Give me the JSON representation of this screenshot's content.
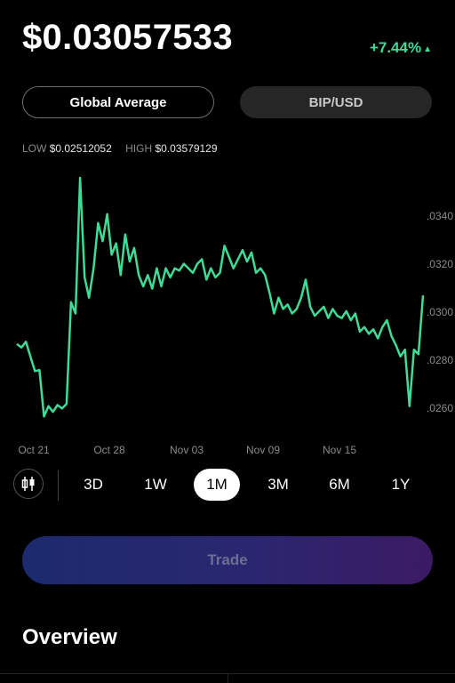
{
  "header": {
    "price": "$0.03057533",
    "change": "+7.44%",
    "change_icon": "triangle-up-icon",
    "change_color": "#3ddc97"
  },
  "toggles": [
    {
      "label": "Global Average",
      "active": true
    },
    {
      "label": "BIP/USD",
      "active": false
    }
  ],
  "stats": {
    "low_label": "LOW",
    "low_value": "$0.02512052",
    "high_label": "HIGH",
    "high_value": "$0.03579129"
  },
  "chart_data": {
    "type": "line",
    "line_color": "#3ddc97",
    "y_ticks": [
      ".0340",
      ".0320",
      ".0300",
      ".0280",
      ".0260"
    ],
    "x_ticks": [
      "Oct 21",
      "Oct 28",
      "Nov 03",
      "Nov 09",
      "Nov 15"
    ],
    "y_range": [
      0.0251,
      0.0358
    ],
    "values": [
      0.02845,
      0.0283,
      0.02855,
      0.0279,
      0.02725,
      0.0273,
      0.02525,
      0.0257,
      0.02545,
      0.02575,
      0.0256,
      0.0258,
      0.0303,
      0.0298,
      0.0358,
      0.0314,
      0.0305,
      0.0318,
      0.0338,
      0.033,
      0.0342,
      0.0324,
      0.0329,
      0.0315,
      0.0333,
      0.0321,
      0.0327,
      0.0315,
      0.031,
      0.0315,
      0.0309,
      0.0318,
      0.031,
      0.0318,
      0.0314,
      0.0318,
      0.0317,
      0.032,
      0.0318,
      0.0316,
      0.032,
      0.0322,
      0.0313,
      0.0318,
      0.0314,
      0.0316,
      0.0328,
      0.0323,
      0.0318,
      0.0322,
      0.0326,
      0.0321,
      0.0325,
      0.0316,
      0.0318,
      0.0315,
      0.0307,
      0.0298,
      0.0305,
      0.03,
      0.0302,
      0.0298,
      0.03,
      0.0305,
      0.0313,
      0.0301,
      0.0297,
      0.0299,
      0.0301,
      0.0296,
      0.03,
      0.0297,
      0.0296,
      0.0299,
      0.0295,
      0.0298,
      0.029,
      0.0292,
      0.0289,
      0.0291,
      0.0287,
      0.0292,
      0.0295,
      0.0288,
      0.0284,
      0.0279,
      0.0282,
      0.0257,
      0.0282,
      0.028,
      0.0306
    ]
  },
  "ranges": {
    "candle_icon": "candlestick-icon",
    "items": [
      {
        "label": "3D",
        "selected": false
      },
      {
        "label": "1W",
        "selected": false
      },
      {
        "label": "1M",
        "selected": true
      },
      {
        "label": "3M",
        "selected": false
      },
      {
        "label": "6M",
        "selected": false
      },
      {
        "label": "1Y",
        "selected": false
      }
    ]
  },
  "trade_button": {
    "label": "Trade"
  },
  "overview": {
    "title": "Overview"
  }
}
